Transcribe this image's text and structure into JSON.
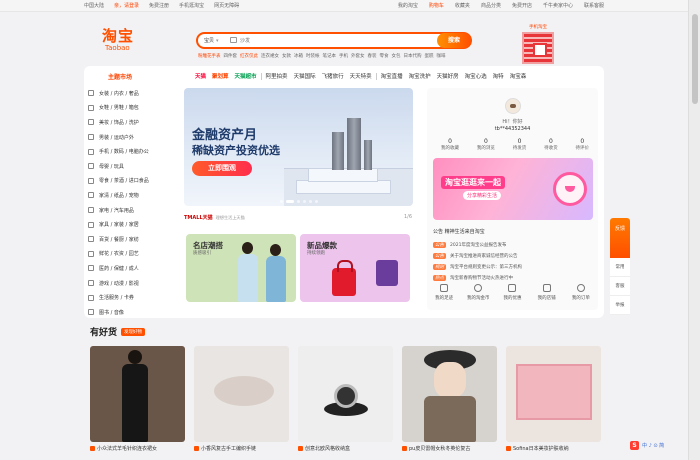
{
  "topbar": {
    "left": [
      "中国大陆",
      "亲，请登录",
      "免费注册",
      "手机逛淘宝",
      "网页无障碍"
    ],
    "right": [
      "我的淘宝",
      "购物车",
      "收藏夹",
      "商品分类",
      "免费开店",
      "千牛卖家中心",
      "联系客服"
    ]
  },
  "header": {
    "logo_cn": "淘宝",
    "logo_en": "Taobao",
    "search_type": "宝贝",
    "search_placeholder": "沙发",
    "search_button": "搜索",
    "hot_words": [
      "粉雕花手表",
      "四件套",
      "红衣仅此",
      "连衣裙女",
      "女款",
      "冰箱",
      "时装帐",
      "笔记本",
      "手机",
      "外套女",
      "春装",
      "零食",
      "女包",
      "日本代购",
      "蛋糕",
      "咖啡"
    ],
    "qr_text": "手机淘宝"
  },
  "categories": {
    "header": "主题市场",
    "items": [
      "女装 / 内衣 / 奢品",
      "女鞋 / 男鞋 / 箱包",
      "美妆 / 饰品 / 洗护",
      "男装 / 运动户外",
      "手机 / 数码 / 电脑办公",
      "母婴 / 玩具",
      "零食 / 茶酒 / 进口食品",
      "家清 / 纸品 / 宠物",
      "家电 / 汽车用品",
      "家具 / 家装 / 家居",
      "百货 / 餐厨 / 家纺",
      "鲜花 / 农资 / 园艺",
      "医药 / 保健 / 成人",
      "游戏 / 动漫 / 影视",
      "生活服务 / 卡券",
      "图书 / 音像"
    ]
  },
  "nav": {
    "items": [
      "天猫",
      "聚划算",
      "天猫超市",
      "阿里拍卖",
      "天猫国际",
      "飞猪旅行",
      "天天特卖",
      "淘宝直播",
      "淘宝洗护",
      "天猫好房",
      "淘宝心选",
      "淘特",
      "淘宝森"
    ]
  },
  "banner": {
    "title": "金融资产月",
    "subtitle": "稀缺资产投资优选",
    "button": "立即围观"
  },
  "tmall": {
    "brand": "TMALL天猫",
    "sub": "理想生活上天猫",
    "pager": "1/6"
  },
  "promos": [
    {
      "title": "名店潮搭",
      "sub": "质感吸引"
    },
    {
      "title": "新品爆款",
      "sub": "持续领跑"
    }
  ],
  "user": {
    "greeting": "Hi！你好",
    "name": "tb**44352344",
    "stats": [
      {
        "num": "0",
        "label": "我的收藏"
      },
      {
        "num": "0",
        "label": "我的浏览"
      },
      {
        "num": "0",
        "label": "待发货"
      },
      {
        "num": "0",
        "label": "待收货"
      },
      {
        "num": "0",
        "label": "待评价"
      }
    ]
  },
  "promo_banner": {
    "title": "淘宝逛逛来一起",
    "sub": "分享精彩生活"
  },
  "news": {
    "header": "公告 精神生活来自淘宝",
    "rows": [
      {
        "tag": "公告",
        "text": "2021年度淘宝公益报告发布"
      },
      {
        "tag": "公告",
        "text": "关于淘宝推进商家诚信经营的公告"
      },
      {
        "tag": "规则",
        "text": "淘宝平台规则变更公示：第三方机构"
      },
      {
        "tag": "热点",
        "text": "淘宝新春购物节活动火热进行中"
      }
    ]
  },
  "tools": [
    "我的足迹",
    "我的淘金币",
    "我的优惠",
    "我的店铺",
    "我的订单"
  ],
  "float_bar": {
    "top": "反馈",
    "items": [
      "常用",
      "客服",
      "举报"
    ]
  },
  "good": {
    "title": "有好货",
    "tag": "发现好物",
    "products": [
      "小众法式羊毛针织连衣裙女",
      "小香风复古手工编织手链",
      "创意北欧风格收纳盒",
      "pu皮贝雷帽女秋冬英伦复古",
      "Sofina日本美妆护肤收纳"
    ]
  },
  "float_logo": {
    "mark": "S",
    "text": "中 ♪ ⊙ 简"
  },
  "colors": {
    "brand": "#ff5000",
    "tmall_red": "#ff0036",
    "page_bg": "#f2f2f4"
  }
}
